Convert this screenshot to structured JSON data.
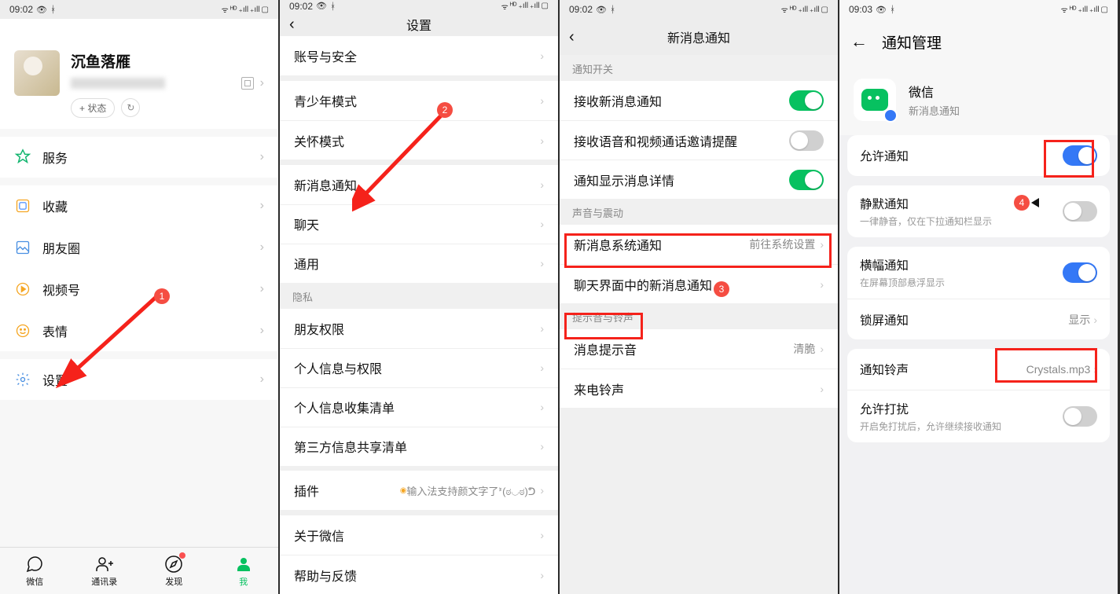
{
  "colors": {
    "accent_green": "#07c160",
    "accent_blue": "#3478f6",
    "annotation_red": "#f5221b"
  },
  "annotations": {
    "badge1": "1",
    "badge2": "2",
    "badge3": "3",
    "badge4": "4"
  },
  "screen1": {
    "time": "09:02",
    "profile_name": "沉鱼落雁",
    "status_btn": "+ 状态",
    "items": {
      "service": "服务",
      "favorites": "收藏",
      "moments": "朋友圈",
      "channels": "视频号",
      "stickers": "表情",
      "settings": "设置"
    },
    "tabs": {
      "wechat": "微信",
      "contacts": "通讯录",
      "discover": "发现",
      "me": "我"
    }
  },
  "screen2": {
    "time": "09:02",
    "title": "设置",
    "items": {
      "account": "账号与安全",
      "youth": "青少年模式",
      "care": "关怀模式",
      "notifications": "新消息通知",
      "chat": "聊天",
      "general": "通用",
      "privacy_header": "隐私",
      "friends_perm": "朋友权限",
      "personal_info": "个人信息与权限",
      "info_list": "个人信息收集清单",
      "thirdparty": "第三方信息共享清单",
      "plugins": "插件",
      "plugins_hint": "输入法支持颜文字了ᕑ(ಠ◡ಠ)ᕤ",
      "about": "关于微信",
      "help": "帮助与反馈"
    }
  },
  "screen3": {
    "time": "09:02",
    "title": "新消息通知",
    "section_switch": "通知开关",
    "items": {
      "receive_new": "接收新消息通知",
      "receive_call": "接收语音和视频通话邀请提醒",
      "show_detail": "通知显示消息详情",
      "section_sound": "声音与震动",
      "sys_notify": "新消息系统通知",
      "sys_notify_value": "前往系统设置",
      "chat_notify": "聊天界面中的新消息通知",
      "section_tone": "提示音与铃声",
      "msg_tone": "消息提示音",
      "msg_tone_value": "清脆",
      "call_tone": "来电铃声"
    },
    "toggles": {
      "receive_new": true,
      "receive_call": false,
      "show_detail": true
    }
  },
  "screen4": {
    "time": "09:03",
    "title": "通知管理",
    "app_name": "微信",
    "app_sub": "新消息通知",
    "rows": {
      "allow": "允许通知",
      "silent": "静默通知",
      "silent_sub": "一律静音，仅在下拉通知栏显示",
      "banner": "横幅通知",
      "banner_sub": "在屏幕顶部悬浮显示",
      "lock": "锁屏通知",
      "lock_value": "显示",
      "ringtone": "通知铃声",
      "ringtone_value": "Crystals.mp3",
      "dnd": "允许打扰",
      "dnd_sub": "开启免打扰后，允许继续接收通知"
    },
    "toggles": {
      "allow": true,
      "silent": false,
      "banner": true,
      "dnd": false
    }
  }
}
